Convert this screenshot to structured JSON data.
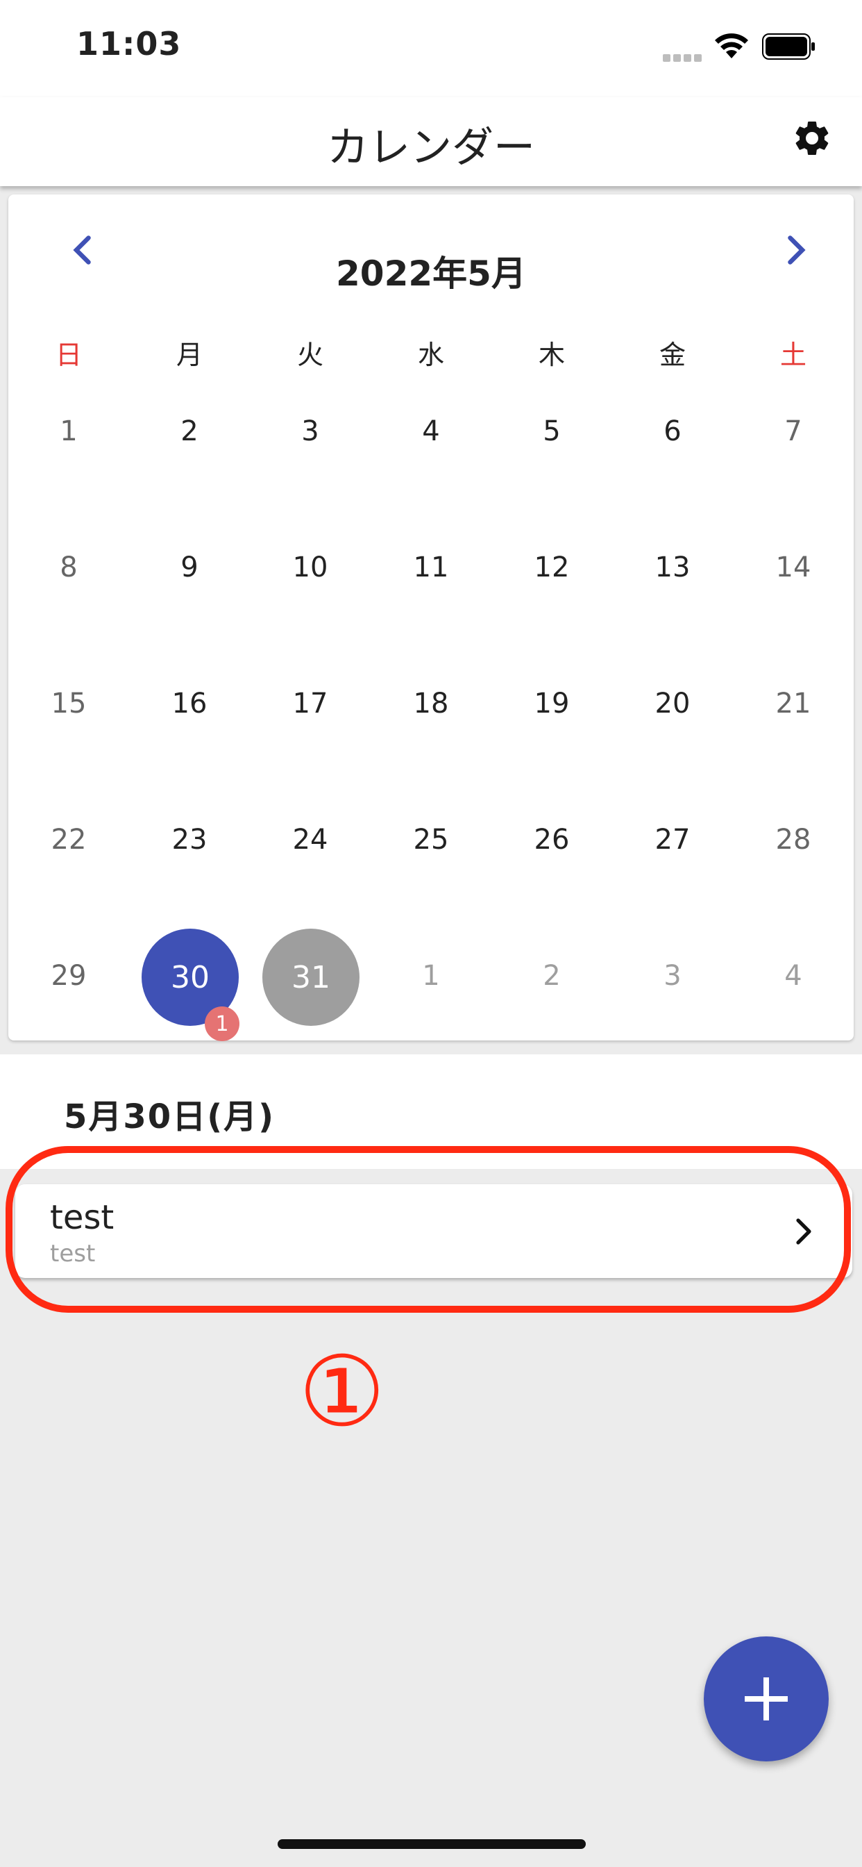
{
  "status_bar": {
    "time": "11:03"
  },
  "header": {
    "title": "カレンダー"
  },
  "calendar": {
    "month_label": "2022年5月",
    "weekdays": [
      "日",
      "月",
      "火",
      "水",
      "木",
      "金",
      "土"
    ],
    "weeks": [
      [
        "1",
        "2",
        "3",
        "4",
        "5",
        "6",
        "7"
      ],
      [
        "8",
        "9",
        "10",
        "11",
        "12",
        "13",
        "14"
      ],
      [
        "15",
        "16",
        "17",
        "18",
        "19",
        "20",
        "21"
      ],
      [
        "22",
        "23",
        "24",
        "25",
        "26",
        "27",
        "28"
      ],
      [
        "29",
        "30",
        "31",
        "1",
        "2",
        "3",
        "4"
      ]
    ],
    "selected_day": "30",
    "selected_badge": "1",
    "today_day": "31",
    "colors": {
      "accent": "#3f51b5",
      "today": "#9e9e9e",
      "weekend_header": "#e53935",
      "badge": "#e57373"
    }
  },
  "selected_date": {
    "label": "5月30日(月)"
  },
  "events": [
    {
      "title": "test",
      "subtitle": "test"
    }
  ],
  "annotation": {
    "number": "①",
    "color": "#ff2a12"
  }
}
